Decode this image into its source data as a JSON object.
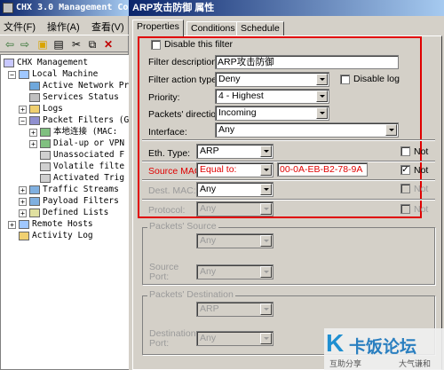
{
  "main": {
    "title": "CHX 3.0 Management Con",
    "menu": [
      "文件(F)",
      "操作(A)",
      "查看(V)"
    ],
    "tree": [
      {
        "label": "CHX Management"
      },
      {
        "label": "Local Machine"
      },
      {
        "label": "Active Network Pr"
      },
      {
        "label": "Services Status"
      },
      {
        "label": "Logs"
      },
      {
        "label": "Packet Filters (G"
      },
      {
        "label": "本地连接 (MAC:"
      },
      {
        "label": "Dial-up or VPN"
      },
      {
        "label": "Unassociated F"
      },
      {
        "label": "Volatile filte"
      },
      {
        "label": "Activated Trig"
      },
      {
        "label": "Traffic Streams"
      },
      {
        "label": "Payload Filters"
      },
      {
        "label": "Defined Lists"
      },
      {
        "label": "Remote Hosts"
      },
      {
        "label": "Activity Log"
      }
    ]
  },
  "dialog": {
    "title": "ARP攻击防御 属性",
    "tabs": [
      "Properties",
      "Conditions",
      "Schedule"
    ],
    "disable_filter": "Disable this filter",
    "filter_description_label": "Filter description:",
    "filter_description_value": "ARP攻击防御",
    "filter_action_label": "Filter action type:",
    "filter_action_value": "Deny",
    "disable_log": "Disable log",
    "priority_label": "Priority:",
    "priority_value": "4 - Highest",
    "direction_label": "Packets' direction:",
    "direction_value": "Incoming",
    "interface_label": "Interface:",
    "interface_value": "Any",
    "eth_type_label": "Eth. Type:",
    "eth_type_value": "ARP",
    "not_label": "Not",
    "source_mac_label": "Source MAC:",
    "source_mac_op": "Equal to:",
    "source_mac_value": "00-0A-EB-B2-78-9A",
    "dest_mac_label": "Dest. MAC:",
    "dest_mac_value": "Any",
    "protocol_label": "Protocol:",
    "protocol_value": "Any",
    "packets_source_title": "Packets' Source",
    "source_value": "Any",
    "source_port_label": "Source\nPort:",
    "source_port_value": "Any",
    "packets_dest_title": "Packets' Destination",
    "dest_value": "ARP",
    "dest_port_label": "Destination\nPort:",
    "dest_port_value": "Any"
  },
  "watermark": {
    "brand": "卡饭论坛",
    "slogan_left": "互助分享",
    "slogan_right": "大气谦和"
  },
  "colors": {
    "highlight": "#e00000",
    "title_bar": "#0a246a"
  }
}
